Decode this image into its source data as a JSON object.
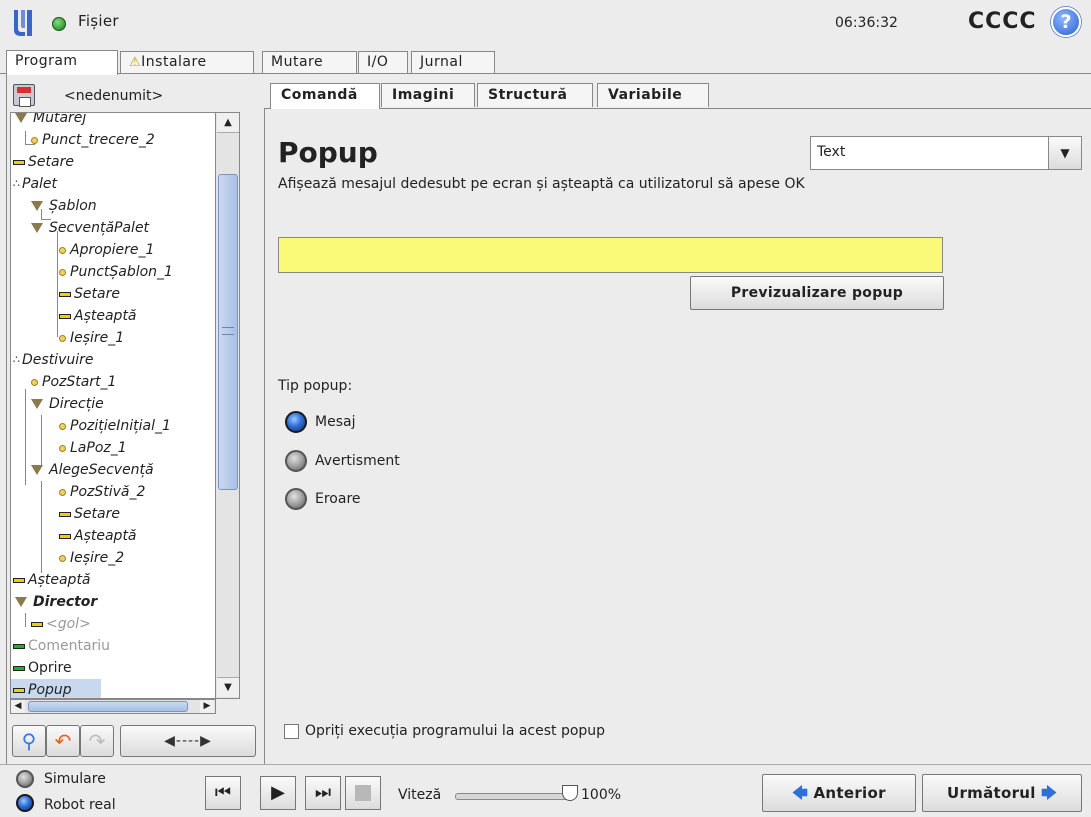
{
  "header": {
    "file_menu": "Fișier",
    "clock": "06:36:32",
    "robot_name": "CCCC",
    "help_glyph": "?"
  },
  "main_tabs": [
    {
      "label": "Program",
      "active": true
    },
    {
      "label": "Instalare",
      "warning": true
    },
    {
      "label": "Mutare"
    },
    {
      "label": "I/O"
    },
    {
      "label": "Jurnal"
    }
  ],
  "left_panel": {
    "program_name": "<nedenumit>",
    "tree": [
      {
        "label": "Mutarej",
        "icon": "triangle-icon",
        "indent": 1
      },
      {
        "label": "Punct_trecere_2",
        "icon": "waypoint-icon",
        "indent": 2
      },
      {
        "label": "Setare",
        "icon": "bar-icon",
        "indent": 0
      },
      {
        "label": "Palet",
        "icon": "pallet-icon",
        "indent": 0
      },
      {
        "label": "Șablon",
        "icon": "triangle-icon",
        "indent": 1
      },
      {
        "label": "SecvențăPalet",
        "icon": "triangle-icon",
        "indent": 1
      },
      {
        "label": "Apropiere_1",
        "icon": "waypoint-icon",
        "indent": 2
      },
      {
        "label": "PunctȘablon_1",
        "icon": "waypoint-icon",
        "indent": 2
      },
      {
        "label": "Setare",
        "icon": "bar-icon",
        "indent": 2
      },
      {
        "label": "Așteaptă",
        "icon": "bar-icon",
        "indent": 2
      },
      {
        "label": "Ieșire_1",
        "icon": "waypoint-icon",
        "indent": 2
      },
      {
        "label": "Destivuire",
        "icon": "pallet-icon",
        "indent": 0
      },
      {
        "label": "PozStart_1",
        "icon": "waypoint-icon",
        "indent": 1
      },
      {
        "label": "Direcție",
        "icon": "triangle-icon",
        "indent": 1
      },
      {
        "label": "PozițieInițial_1",
        "icon": "waypoint-icon",
        "indent": 2
      },
      {
        "label": "LaPoz_1",
        "icon": "waypoint-icon",
        "indent": 2
      },
      {
        "label": "AlegeSecvență",
        "icon": "triangle-icon",
        "indent": 1
      },
      {
        "label": "PozStivă_2",
        "icon": "waypoint-icon",
        "indent": 2
      },
      {
        "label": "Setare",
        "icon": "bar-icon",
        "indent": 2
      },
      {
        "label": "Așteaptă",
        "icon": "bar-icon",
        "indent": 2
      },
      {
        "label": "Ieșire_2",
        "icon": "waypoint-icon",
        "indent": 2
      },
      {
        "label": "Așteaptă",
        "icon": "bar-icon",
        "indent": 0
      },
      {
        "label": "Director",
        "icon": "triangle-icon",
        "indent": 0,
        "bold": true
      },
      {
        "label": "<gol>",
        "icon": "bar-icon",
        "indent": 1,
        "gray": true
      },
      {
        "label": "Comentariu",
        "icon": "bar-green-icon",
        "indent": 0,
        "gray": true
      },
      {
        "label": "Oprire",
        "icon": "bar-green-icon",
        "indent": 0,
        "normal": true
      },
      {
        "label": "Popup",
        "icon": "bar-icon",
        "indent": 0,
        "selected": true
      }
    ],
    "move_button": "◀----▶"
  },
  "sub_tabs": [
    {
      "label": "Comandă",
      "active": true
    },
    {
      "label": "Imagini"
    },
    {
      "label": "Structură"
    },
    {
      "label": "Variabile"
    }
  ],
  "content": {
    "title": "Popup",
    "type_select_value": "Text",
    "description": "Afișează mesajul dedesubt pe ecran și așteaptă ca utilizatorul să apese OK",
    "message_value": "",
    "preview_button": "Previzualizare popup",
    "popup_type_label": "Tip popup:",
    "radio_options": [
      {
        "label": "Mesaj",
        "selected": true
      },
      {
        "label": "Avertisment",
        "selected": false
      },
      {
        "label": "Eroare",
        "selected": false
      }
    ],
    "stop_checkbox_label": "Opriți execuția programului la acest popup",
    "stop_checked": false
  },
  "bottom": {
    "simulation_label": "Simulare",
    "real_robot_label": "Robot real",
    "mode": "real",
    "speed_label": "Viteză",
    "speed_value": "100%",
    "speed_fraction": 1.0,
    "prev_button": "Anterior",
    "next_button": "Următorul"
  },
  "colors": {
    "message_field_bg": "#fafa78",
    "accent_blue": "#2f6fd8",
    "status_green": "#1b7a1b"
  }
}
